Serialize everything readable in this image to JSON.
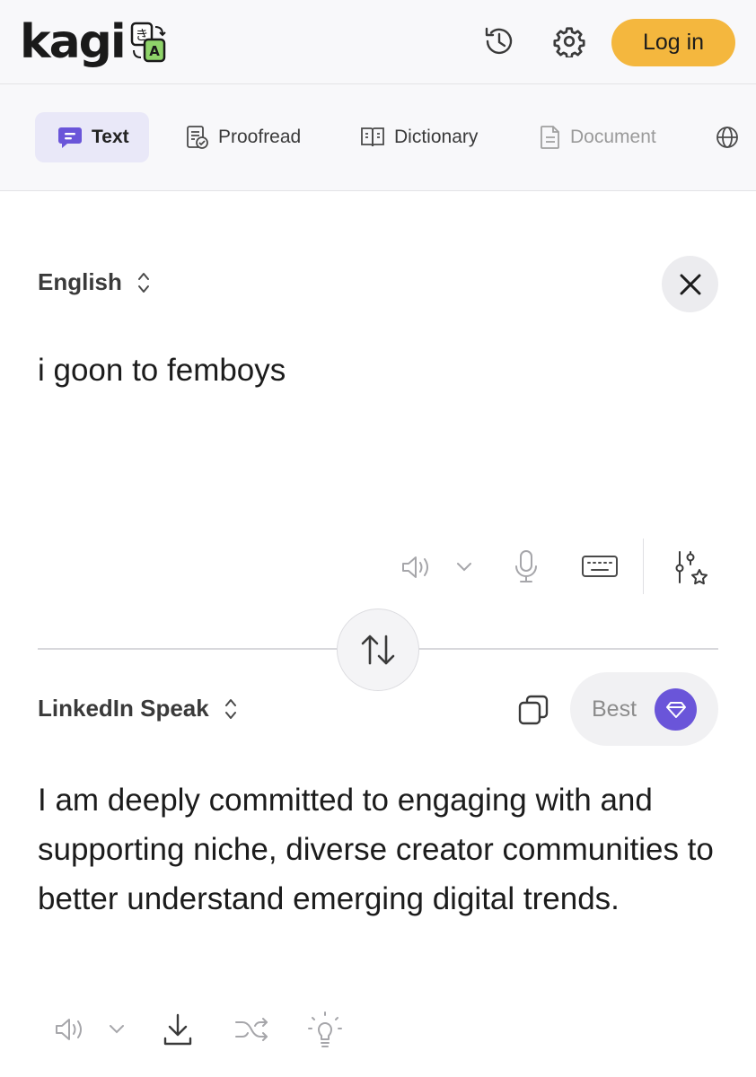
{
  "header": {
    "logo_text": "kagi",
    "logo_badge_icon": "translate-badge-icon",
    "history_icon": "history-icon",
    "settings_icon": "gear-icon",
    "login_label": "Log in",
    "login_color": "#f4b73e"
  },
  "tabs": [
    {
      "label": "Text",
      "icon": "chat-bubble-icon",
      "active": true
    },
    {
      "label": "Proofread",
      "icon": "proofread-icon",
      "active": false
    },
    {
      "label": "Dictionary",
      "icon": "book-icon",
      "active": false
    },
    {
      "label": "Document",
      "icon": "document-icon",
      "active": false,
      "disabled": true
    }
  ],
  "source": {
    "language": "English",
    "text": "i goon to femboys",
    "toolbar": [
      "speaker-icon",
      "chevron-down-icon",
      "microphone-icon",
      "keyboard-icon",
      "settings-sliders-icon"
    ]
  },
  "swap_icon": "swap-arrows-icon",
  "target": {
    "language": "LinkedIn Speak",
    "copy_icon": "copy-icon",
    "quality_label": "Best",
    "quality_icon": "gem-icon",
    "accent_color": "#6a55d9",
    "text": "I am deeply committed to engaging with and supporting niche, diverse creator communities to better understand emerging digital trends.",
    "toolbar": [
      "speaker-icon",
      "chevron-down-icon",
      "download-icon",
      "shuffle-icon",
      "lightbulb-icon"
    ]
  }
}
